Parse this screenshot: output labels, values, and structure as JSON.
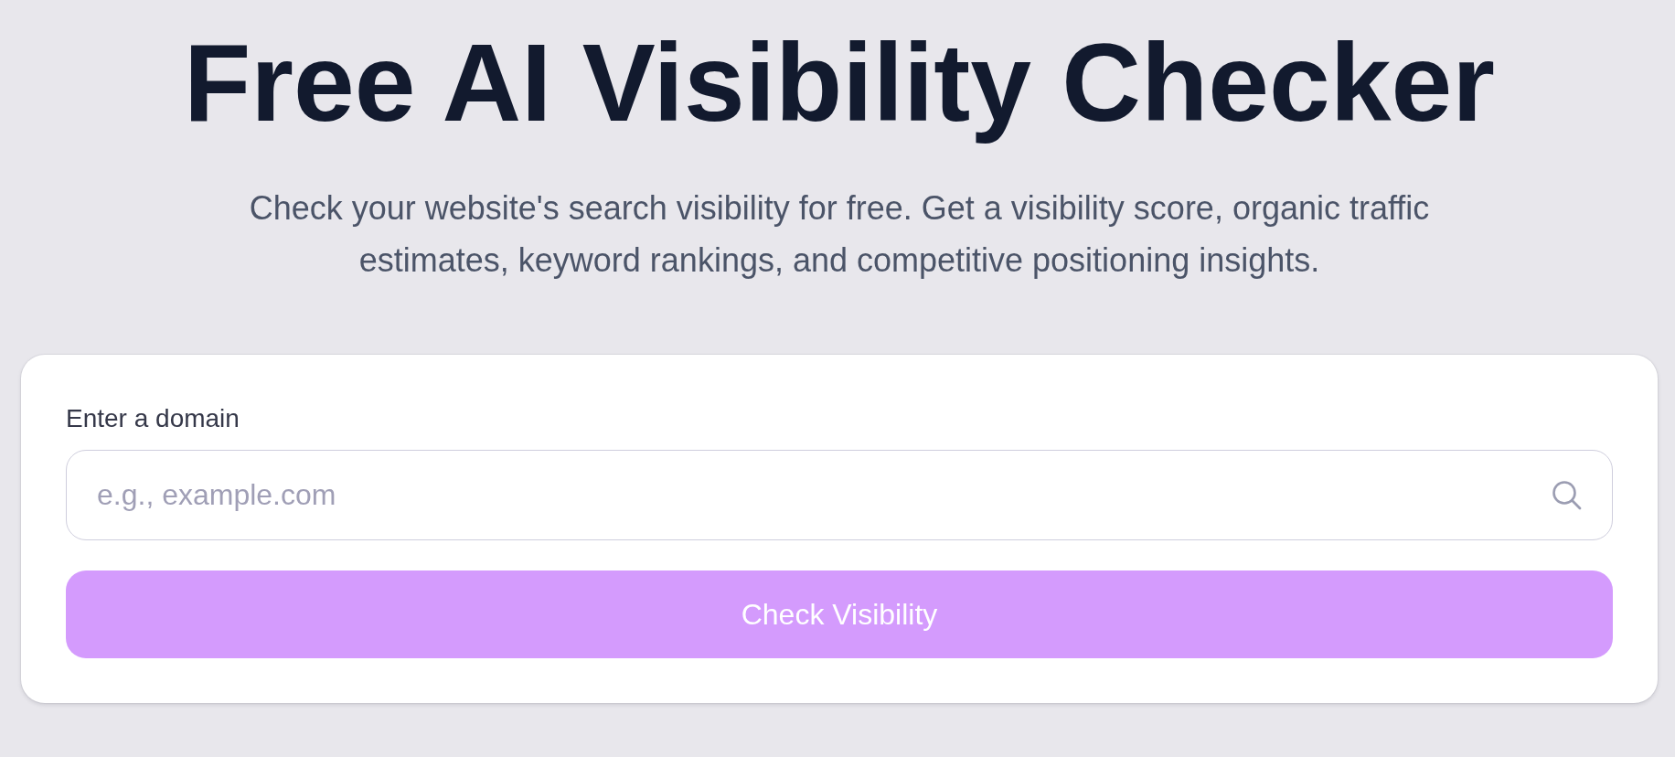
{
  "heading": {
    "title": "Free AI Visibility Checker",
    "subtitle": "Check your website's search visibility for free. Get a visibility score, organic traffic estimates, keyword rankings, and competitive positioning insights."
  },
  "form": {
    "label": "Enter a domain",
    "domain_field": {
      "placeholder": "e.g., example.com"
    },
    "submit_button": {
      "label": "Check Visibility",
      "disabled": true
    }
  }
}
